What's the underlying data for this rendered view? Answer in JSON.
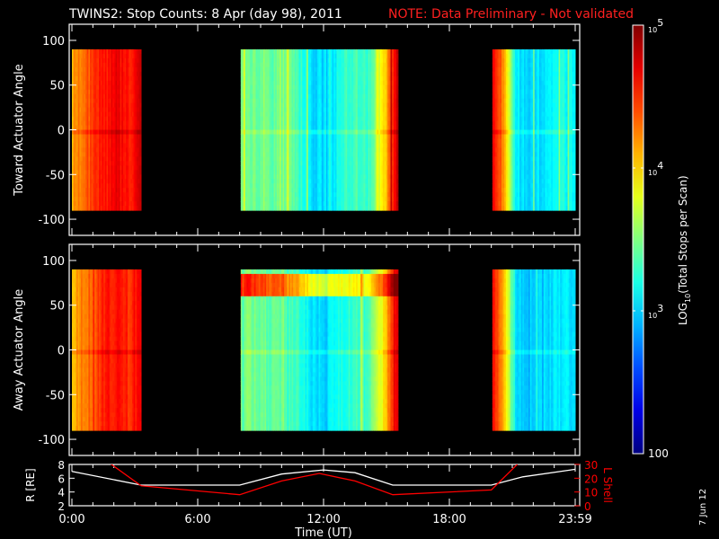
{
  "chart_data": {
    "type": "heatmap",
    "title": "TWINS2: Stop Counts:  8 Apr (day  98), 2011",
    "note": "NOTE: Data Preliminary - Not validated",
    "xlabel": "Time (UT)",
    "x_ticks": [
      "0:00",
      "6:00",
      "12:00",
      "18:00",
      "23:59"
    ],
    "x_tick_hours": [
      0,
      6,
      12,
      18,
      24
    ],
    "xlim_hours": [
      0,
      24
    ],
    "colorbar": {
      "label": "LOG10(Total Stops per Scan)",
      "label_main": "LOG",
      "label_sub": "10",
      "label_rest": "(Total Stops per Scan)",
      "range_log10": [
        2,
        5
      ],
      "ticks": [
        {
          "base": "10",
          "exp": "5",
          "v": 5
        },
        {
          "base": "10",
          "exp": "4",
          "v": 4
        },
        {
          "base": "10",
          "exp": "3",
          "v": 3
        },
        {
          "base": "100",
          "exp": "",
          "v": 2
        }
      ],
      "colormap": "jet"
    },
    "panels": [
      {
        "ylabel": "Toward Actuator Angle",
        "ylim": [
          -110,
          110
        ],
        "yticks": [
          "100",
          "50",
          "0",
          "-50",
          "-100"
        ],
        "ytick_values": [
          100,
          50,
          0,
          -50,
          -100
        ],
        "data_angle_range": [
          -90,
          90
        ],
        "segments": [
          {
            "t_start": 0.0,
            "t_end": 3.3,
            "log10_profile": [
              4.15,
              4.3,
              4.5,
              4.6,
              4.65,
              4.55,
              4.7
            ]
          },
          {
            "t_start": 8.05,
            "t_end": 15.55,
            "log10_profile": [
              3.5,
              3.45,
              3.4,
              3.5,
              3.3,
              3.05,
              3.0,
              3.2,
              3.35,
              3.3,
              3.9,
              4.8
            ]
          },
          {
            "t_start": 20.05,
            "t_end": 24.0,
            "log10_profile": [
              4.7,
              4.2,
              3.1,
              3.0,
              3.05,
              3.1,
              3.2,
              3.1
            ]
          }
        ],
        "high_angle_band": null
      },
      {
        "ylabel": "Away Actuator Angle",
        "ylim": [
          -110,
          110
        ],
        "yticks": [
          "100",
          "50",
          "0",
          "-50",
          "-100"
        ],
        "ytick_values": [
          100,
          50,
          0,
          -50,
          -100
        ],
        "data_angle_range": [
          -90,
          90
        ],
        "segments": [
          {
            "t_start": 0.0,
            "t_end": 3.3,
            "log10_profile": [
              4.1,
              4.25,
              4.4,
              4.55,
              4.6,
              4.5,
              4.65
            ]
          },
          {
            "t_start": 8.05,
            "t_end": 15.55,
            "log10_profile": [
              3.5,
              3.45,
              3.4,
              3.45,
              3.3,
              3.05,
              3.0,
              3.2,
              3.3,
              3.3,
              3.9,
              4.8
            ]
          },
          {
            "t_start": 20.05,
            "t_end": 24.0,
            "log10_profile": [
              4.6,
              4.1,
              3.0,
              2.95,
              3.0,
              3.05,
              3.1,
              3.05
            ]
          }
        ],
        "high_angle_band": {
          "angle_min": 65,
          "angle_max": 85,
          "log10_boost": 1.1
        }
      }
    ],
    "orbit": {
      "ylabel_left": "R [RE]",
      "ylabel_left_main": "R [R",
      "ylabel_left_sub": "E",
      "ylabel_left_end": "]",
      "yticks_left": [
        "2",
        "4",
        "6",
        "8"
      ],
      "ylim_left": [
        2,
        8
      ],
      "ylabel_right": "L Shell",
      "yticks_right": [
        "0",
        "10",
        "20",
        "30"
      ],
      "ylim_right": [
        0,
        30
      ],
      "r_series": {
        "name": "R",
        "color": "#ffffff",
        "t": [
          0,
          3.3,
          8,
          10,
          12,
          13.5,
          15.3,
          20,
          21.5,
          24
        ],
        "values": [
          7.0,
          5.0,
          5.0,
          6.6,
          7.2,
          6.8,
          5.0,
          5.0,
          6.2,
          7.3
        ]
      },
      "l_series": {
        "name": "L Shell",
        "color": "#ff0000",
        "t": [
          1.7,
          3.3,
          8,
          10,
          11.8,
          13.5,
          15.3,
          20,
          21.3
        ],
        "values": [
          32,
          14.5,
          8,
          18,
          23.5,
          18,
          8,
          11.5,
          31
        ]
      }
    },
    "date_stamp": "7 Jun 12"
  }
}
